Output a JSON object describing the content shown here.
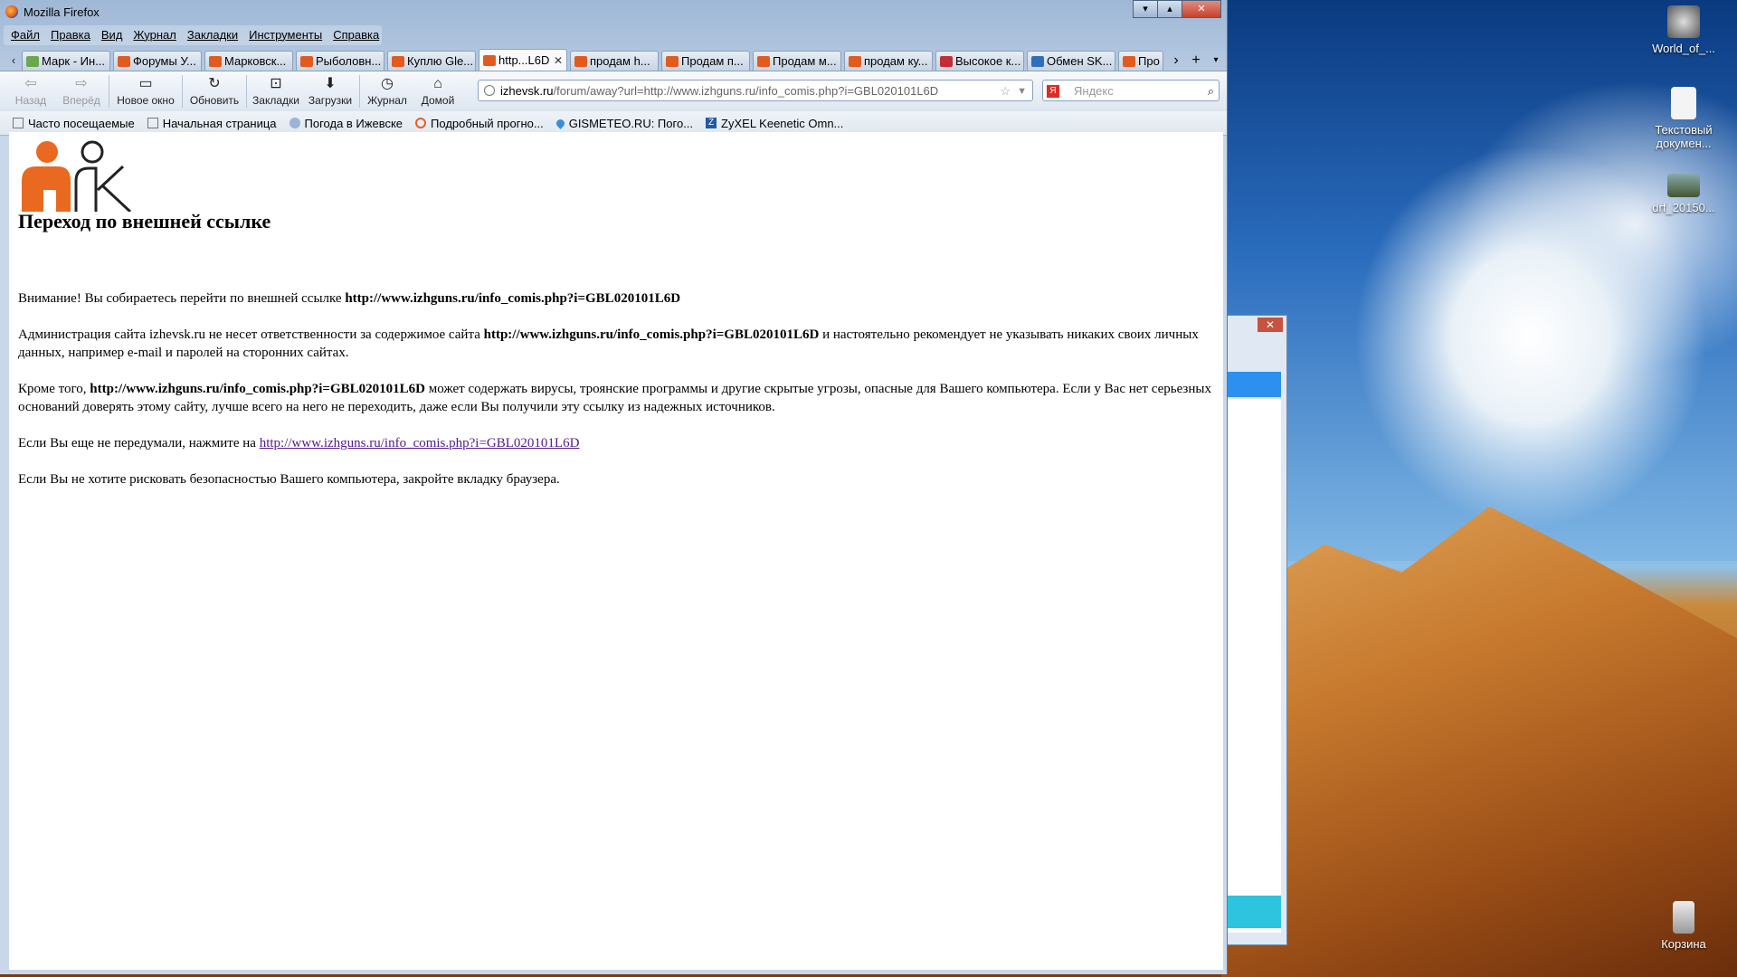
{
  "window": {
    "title": "Mozilla Firefox"
  },
  "menu": [
    "Файл",
    "Правка",
    "Вид",
    "Журнал",
    "Закладки",
    "Инструменты",
    "Справка"
  ],
  "tabs": [
    {
      "label": "Марк - Ин...",
      "icon": "green"
    },
    {
      "label": "Форумы У...",
      "icon": "izh"
    },
    {
      "label": "Марковск...",
      "icon": "izh"
    },
    {
      "label": "Рыболовн...",
      "icon": "izh"
    },
    {
      "label": "Куплю Gle...",
      "icon": "izh"
    },
    {
      "label": "http...L6D",
      "icon": "izh",
      "active": true
    },
    {
      "label": "продам h...",
      "icon": "izh"
    },
    {
      "label": "Продам п...",
      "icon": "izh"
    },
    {
      "label": "Продам м...",
      "icon": "izh"
    },
    {
      "label": "продам ку...",
      "icon": "izh"
    },
    {
      "label": "Высокое к...",
      "icon": "red"
    },
    {
      "label": "Обмен SK...",
      "icon": "blue"
    },
    {
      "label": "Про",
      "icon": "izh"
    }
  ],
  "toolbar": {
    "back": "Назад",
    "forward": "Вперёд",
    "new_window": "Новое окно",
    "reload": "Обновить",
    "bookmarks": "Закладки",
    "downloads": "Загрузки",
    "history": "Журнал",
    "home": "Домой"
  },
  "urlbar": {
    "host": "izhevsk.ru",
    "path": "/forum/away?url=http://www.izhguns.ru/info_comis.php?i=GBL020101L6D"
  },
  "search": {
    "placeholder": "Яндекс",
    "engine_letter": "Я"
  },
  "bookmarks": [
    "Часто посещаемые",
    "Начальная страница",
    "Погода в Ижевске",
    "Подробный прогно...",
    "GISMETEO.RU: Пого...",
    "ZyXEL Keenetic Omn..."
  ],
  "page": {
    "heading": "Переход по внешней ссылке",
    "p1_text": "Внимание! Вы собираетесь перейти по внешней ссылке ",
    "url": "http://www.izhguns.ru/info_comis.php?i=GBL020101L6D",
    "p2_a": "Администрация сайта izhevsk.ru не несет ответственности за содержимое сайта ",
    "p2_b": " и настоятельно рекомендует не указывать никаких своих личных данных, например e-mail и паролей на сторонних сайтах.",
    "p3_a": "Кроме того, ",
    "p3_b": " может содержать вирусы, троянские программы и другие скрытые угрозы, опасные для Вашего компьютера. Если у Вас нет серьезных оснований доверять этому сайту, лучше всего на него не переходить, даже если Вы получили эту ссылку из надежных источников.",
    "p4_a": "Если Вы еще не передумали, нажмите на ",
    "p5": "Если Вы не хотите рисковать безопасностью Вашего компьютера, закройте вкладку браузера."
  },
  "desktop": {
    "icons": [
      "World_of_...",
      "Текстовый докумен...",
      "drf_20150...",
      "Корзина"
    ]
  }
}
